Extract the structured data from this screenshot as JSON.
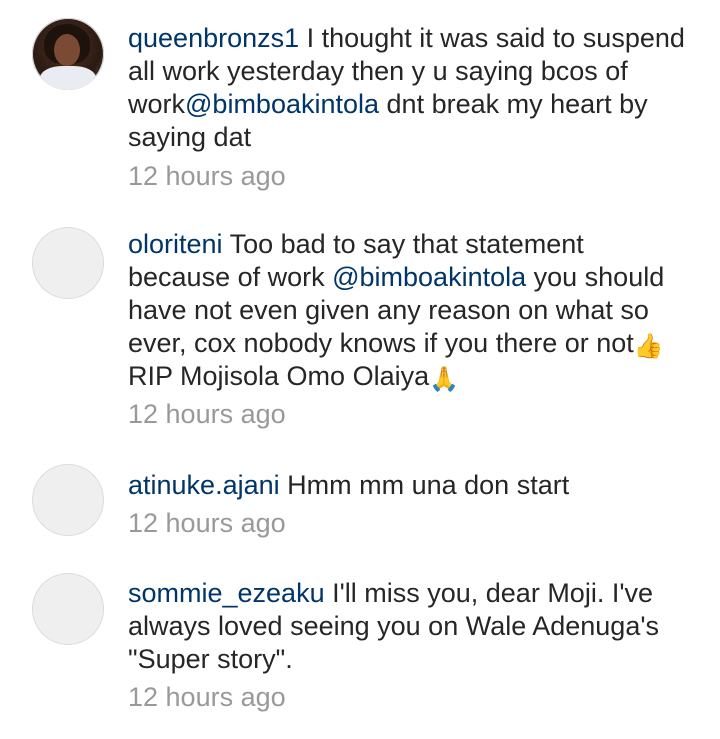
{
  "comments": [
    {
      "username": "queenbronzs1",
      "text_before": " I thought it was said to suspend all work yesterday then y u saying bcos of work",
      "mention": "@bimboakintola",
      "text_after": " dnt break my heart by saying dat",
      "time": "12 hours ago",
      "avatar": "profile-photo"
    },
    {
      "username": "oloriteni",
      "text_before": " Too bad to say that statement because of work ",
      "mention": "@bimboakintola",
      "text_after": " you should have not even given any reason on what so ever, cox nobody knows if you there or not",
      "emoji1": "👍",
      "text_after2": " RIP Mojisola Omo Olaiya",
      "emoji2": "🙏",
      "time": "12 hours ago",
      "avatar": "default-avatar"
    },
    {
      "username": "atinuke.ajani",
      "text": " Hmm mm una don start",
      "time": "12 hours ago",
      "avatar": "default-avatar"
    },
    {
      "username": "sommie_ezeaku",
      "text": " I'll miss you, dear Moji. I've always loved seeing you on Wale Adenuga's \"Super story\".",
      "time": "12 hours ago",
      "avatar": "default-avatar"
    }
  ]
}
